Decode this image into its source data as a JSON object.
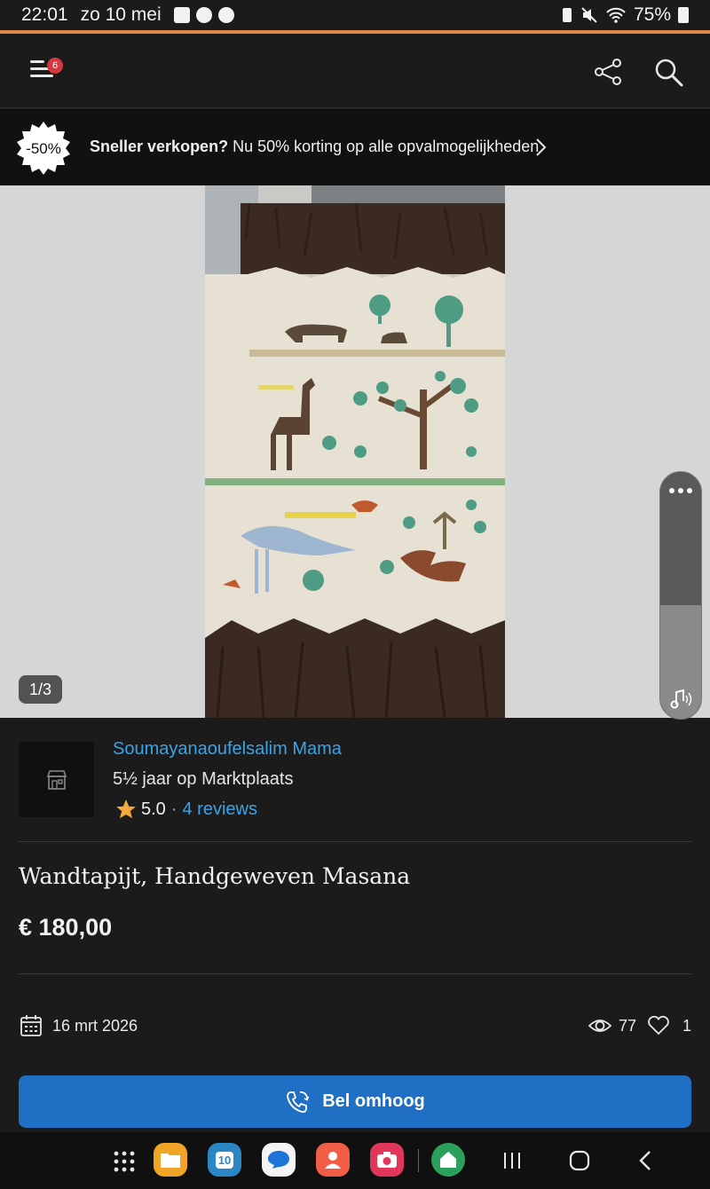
{
  "status_bar": {
    "time": "22:01",
    "date": "zo 10 mei",
    "battery": "75%"
  },
  "app_bar": {
    "menu_badge": "6"
  },
  "promo": {
    "badge": "-50%",
    "bold": "Sneller verkopen?",
    "text": " Nu 50% korting op alle opvalmogelijkheden"
  },
  "gallery": {
    "counter": "1/3"
  },
  "seller": {
    "name": "Soumayanaoufelsalim Mama",
    "years": "5½ jaar op Marktplaats",
    "rating": "5.0",
    "separator": "·",
    "reviews": "4 reviews"
  },
  "listing": {
    "title": "Wandtapijt, Handgeweven Masana",
    "price": "€ 180,00",
    "date": "16 mrt 2026",
    "views": "77",
    "favorites": "1"
  },
  "cta": {
    "label": "Bel omhoog"
  },
  "navbar": {
    "calendar_day": "10"
  },
  "colors": {
    "accent_line": "#e0884a",
    "link": "#3ba3e6",
    "cta": "#1f6fc4",
    "badge": "#d5373e"
  }
}
